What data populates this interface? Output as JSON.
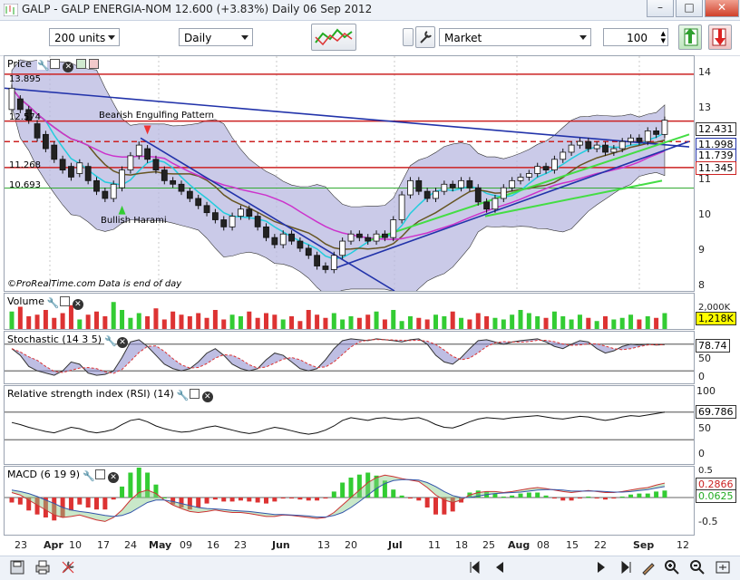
{
  "window": {
    "title": "GALP - GALP ENERGIA-NOM   12.600 (+3.83%)   Daily  06 Sep 2012"
  },
  "toolbar": {
    "units": "200 units",
    "period": "Daily",
    "order_type": "Market",
    "quantity": "100"
  },
  "price_pane": {
    "label": "Price",
    "level_labels": {
      "l13895": "13.895",
      "l12574": "12.574",
      "l11268": "11.268",
      "l10693": "10.693"
    },
    "annotations": {
      "bearish": "Bearish Engulfing Pattern",
      "bullish": "Bullish Harami"
    },
    "credit": "©ProRealTime.com  Data is end of day",
    "axis_ticks": [
      "14",
      "13",
      "12",
      "11",
      "10",
      "9",
      "8"
    ],
    "value_boxes": {
      "last": "12.431",
      "b1": "11.998",
      "b2": "11.739",
      "b3": "11.345"
    }
  },
  "volume_pane": {
    "label": "Volume",
    "axis_ticks": [
      "2,000K"
    ],
    "value_box": "1,218K"
  },
  "stoch_pane": {
    "label": "Stochastic (14 3 5)",
    "axis_ticks": [
      "50",
      "0"
    ],
    "value_box": "78.74"
  },
  "rsi_pane": {
    "label": "Relative strength index (RSI) (14)",
    "axis_ticks": [
      "100",
      "50",
      "0"
    ],
    "value_box": "69.786"
  },
  "macd_pane": {
    "label": "MACD (6 19 9)",
    "axis_ticks": [
      "0.5",
      "-0.5"
    ],
    "value_boxes": {
      "macd": "0.2866",
      "signal": "0.0625"
    }
  },
  "x_axis": {
    "labels": [
      {
        "t": "23",
        "b": false
      },
      {
        "t": "Apr",
        "b": true
      },
      {
        "t": "10",
        "b": false
      },
      {
        "t": "17",
        "b": false
      },
      {
        "t": "24",
        "b": false
      },
      {
        "t": "May",
        "b": true
      },
      {
        "t": "09",
        "b": false
      },
      {
        "t": "16",
        "b": false
      },
      {
        "t": "23",
        "b": false
      },
      {
        "t": "Jun",
        "b": true
      },
      {
        "t": "13",
        "b": false
      },
      {
        "t": "20",
        "b": false
      },
      {
        "t": "Jul",
        "b": true
      },
      {
        "t": "11",
        "b": false
      },
      {
        "t": "18",
        "b": false
      },
      {
        "t": "25",
        "b": false
      },
      {
        "t": "Aug",
        "b": true
      },
      {
        "t": "08",
        "b": false
      },
      {
        "t": "15",
        "b": false
      },
      {
        "t": "22",
        "b": false
      },
      {
        "t": "Sep",
        "b": true
      },
      {
        "t": "12",
        "b": false
      }
    ]
  },
  "colors": {
    "bull": "#33cc33",
    "bear": "#dd3333",
    "band": "#b8b8e0",
    "trend": "#2233aa",
    "hline": "#cc2222"
  },
  "chart_data": {
    "type": "candlestick",
    "price_ylim": [
      7.8,
      14.4
    ],
    "levels": [
      13.895,
      12.574,
      11.998,
      11.268,
      10.693
    ],
    "series": [
      {
        "values": [
          [
            12.9,
            13.5
          ],
          [
            13.2,
            12.9
          ],
          [
            12.9,
            12.6
          ],
          [
            12.5,
            12.1
          ],
          [
            12.2,
            11.8
          ],
          [
            11.9,
            11.5
          ],
          [
            11.5,
            11.2
          ],
          [
            11.3,
            11.0
          ],
          [
            11.1,
            11.4
          ],
          [
            11.3,
            10.9
          ],
          [
            10.9,
            10.6
          ],
          [
            10.6,
            10.4
          ],
          [
            10.4,
            10.8
          ],
          [
            10.7,
            11.2
          ],
          [
            11.2,
            11.6
          ],
          [
            11.6,
            11.9
          ],
          [
            11.8,
            11.5
          ],
          [
            11.5,
            11.2
          ],
          [
            11.2,
            10.9
          ],
          [
            10.9,
            10.8
          ],
          [
            10.8,
            10.6
          ],
          [
            10.6,
            10.4
          ],
          [
            10.4,
            10.2
          ],
          [
            10.2,
            10.0
          ],
          [
            10.0,
            9.8
          ],
          [
            9.8,
            9.6
          ],
          [
            9.6,
            9.9
          ],
          [
            9.9,
            10.1
          ],
          [
            10.1,
            9.9
          ],
          [
            9.9,
            9.6
          ],
          [
            9.6,
            9.3
          ],
          [
            9.3,
            9.1
          ],
          [
            9.1,
            9.4
          ],
          [
            9.4,
            9.2
          ],
          [
            9.2,
            9.0
          ],
          [
            9.0,
            8.8
          ],
          [
            8.8,
            8.5
          ],
          [
            8.5,
            8.4
          ],
          [
            8.4,
            8.8
          ],
          [
            8.8,
            9.2
          ],
          [
            9.2,
            9.4
          ],
          [
            9.4,
            9.3
          ],
          [
            9.3,
            9.2
          ],
          [
            9.2,
            9.4
          ],
          [
            9.4,
            9.3
          ],
          [
            9.3,
            9.8
          ],
          [
            9.8,
            10.5
          ],
          [
            10.5,
            10.9
          ],
          [
            10.9,
            10.6
          ],
          [
            10.6,
            10.4
          ],
          [
            10.4,
            10.6
          ],
          [
            10.6,
            10.8
          ],
          [
            10.8,
            10.7
          ],
          [
            10.7,
            10.9
          ],
          [
            10.9,
            10.7
          ],
          [
            10.7,
            10.3
          ],
          [
            10.3,
            10.1
          ],
          [
            10.1,
            10.4
          ],
          [
            10.4,
            10.7
          ],
          [
            10.7,
            10.9
          ],
          [
            10.9,
            11.0
          ],
          [
            11.0,
            11.1
          ],
          [
            11.1,
            11.3
          ],
          [
            11.3,
            11.2
          ],
          [
            11.2,
            11.5
          ],
          [
            11.5,
            11.7
          ],
          [
            11.7,
            11.9
          ],
          [
            11.9,
            12.0
          ],
          [
            12.0,
            11.8
          ],
          [
            11.8,
            11.9
          ],
          [
            11.9,
            11.7
          ],
          [
            11.7,
            11.8
          ],
          [
            11.8,
            12.0
          ],
          [
            12.0,
            12.1
          ],
          [
            12.1,
            12.0
          ],
          [
            12.0,
            12.3
          ],
          [
            12.3,
            12.2
          ],
          [
            12.2,
            12.6
          ]
        ]
      }
    ],
    "volume": [
      55,
      70,
      40,
      45,
      60,
      35,
      50,
      75,
      30,
      45,
      55,
      40,
      85,
      60,
      35,
      50,
      40,
      65,
      30,
      55,
      45,
      40,
      50,
      35,
      60,
      30,
      45,
      40,
      55,
      35,
      50,
      45,
      30,
      40,
      25,
      60,
      45,
      35,
      50,
      30,
      40,
      35,
      45,
      55,
      30,
      60,
      25,
      40,
      35,
      30,
      45,
      40,
      55,
      35,
      30,
      50,
      40,
      35,
      30,
      45,
      60,
      50,
      40,
      35,
      55,
      40,
      30,
      45,
      35,
      25,
      40,
      30,
      35,
      45,
      30,
      40,
      35,
      50
    ],
    "stochastic": [
      {
        "name": "K",
        "values": [
          70,
          55,
          30,
          20,
          15,
          10,
          20,
          40,
          35,
          15,
          10,
          12,
          20,
          50,
          85,
          90,
          75,
          55,
          35,
          25,
          20,
          25,
          40,
          60,
          70,
          55,
          35,
          25,
          20,
          25,
          45,
          60,
          55,
          40,
          25,
          20,
          25,
          45,
          70,
          88,
          92,
          90,
          88,
          92,
          90,
          88,
          85,
          90,
          92,
          80,
          55,
          40,
          35,
          50,
          70,
          88,
          90,
          85,
          80,
          85,
          88,
          90,
          92,
          85,
          75,
          70,
          80,
          88,
          85,
          70,
          60,
          65,
          75,
          80,
          78,
          80,
          78,
          79
        ]
      }
    ],
    "rsi": [
      {
        "name": "RSI",
        "values": [
          55,
          52,
          48,
          45,
          42,
          40,
          44,
          48,
          46,
          42,
          40,
          42,
          45,
          52,
          58,
          60,
          56,
          50,
          46,
          43,
          41,
          42,
          45,
          48,
          50,
          47,
          44,
          41,
          39,
          41,
          45,
          48,
          46,
          43,
          40,
          38,
          40,
          44,
          50,
          58,
          62,
          60,
          58,
          61,
          62,
          60,
          59,
          61,
          62,
          58,
          52,
          48,
          47,
          51,
          56,
          60,
          62,
          61,
          60,
          62,
          63,
          64,
          65,
          63,
          61,
          60,
          62,
          64,
          63,
          60,
          58,
          60,
          63,
          65,
          64,
          66,
          68,
          70
        ]
      }
    ],
    "macd": {
      "series": [
        {
          "name": "MACD",
          "values": [
            0.1,
            0.05,
            -0.05,
            -0.15,
            -0.25,
            -0.35,
            -0.4,
            -0.38,
            -0.35,
            -0.4,
            -0.45,
            -0.48,
            -0.4,
            -0.25,
            -0.05,
            0.1,
            0.15,
            0.08,
            -0.05,
            -0.15,
            -0.22,
            -0.28,
            -0.3,
            -0.28,
            -0.25,
            -0.28,
            -0.3,
            -0.3,
            -0.32,
            -0.35,
            -0.38,
            -0.38,
            -0.35,
            -0.36,
            -0.38,
            -0.4,
            -0.42,
            -0.4,
            -0.3,
            -0.15,
            0.0,
            0.15,
            0.3,
            0.4,
            0.45,
            0.42,
            0.38,
            0.35,
            0.32,
            0.2,
            0.05,
            -0.05,
            -0.1,
            -0.05,
            0.05,
            0.1,
            0.12,
            0.12,
            0.1,
            0.12,
            0.15,
            0.18,
            0.2,
            0.18,
            0.15,
            0.12,
            0.1,
            0.12,
            0.14,
            0.12,
            0.1,
            0.1,
            0.12,
            0.15,
            0.18,
            0.2,
            0.25,
            0.29
          ]
        },
        {
          "name": "Signal",
          "values": [
            0.15,
            0.12,
            0.08,
            0.02,
            -0.05,
            -0.12,
            -0.2,
            -0.25,
            -0.28,
            -0.3,
            -0.33,
            -0.36,
            -0.38,
            -0.36,
            -0.3,
            -0.2,
            -0.1,
            -0.05,
            -0.05,
            -0.08,
            -0.12,
            -0.16,
            -0.2,
            -0.22,
            -0.23,
            -0.24,
            -0.26,
            -0.27,
            -0.28,
            -0.3,
            -0.32,
            -0.34,
            -0.34,
            -0.35,
            -0.36,
            -0.37,
            -0.39,
            -0.39,
            -0.36,
            -0.3,
            -0.2,
            -0.08,
            0.05,
            0.18,
            0.28,
            0.34,
            0.36,
            0.36,
            0.35,
            0.3,
            0.22,
            0.12,
            0.04,
            0.0,
            0.0,
            0.03,
            0.06,
            0.08,
            0.09,
            0.1,
            0.11,
            0.13,
            0.15,
            0.16,
            0.16,
            0.15,
            0.13,
            0.13,
            0.13,
            0.13,
            0.12,
            0.11,
            0.11,
            0.12,
            0.14,
            0.16,
            0.19,
            0.22
          ]
        }
      ]
    }
  }
}
